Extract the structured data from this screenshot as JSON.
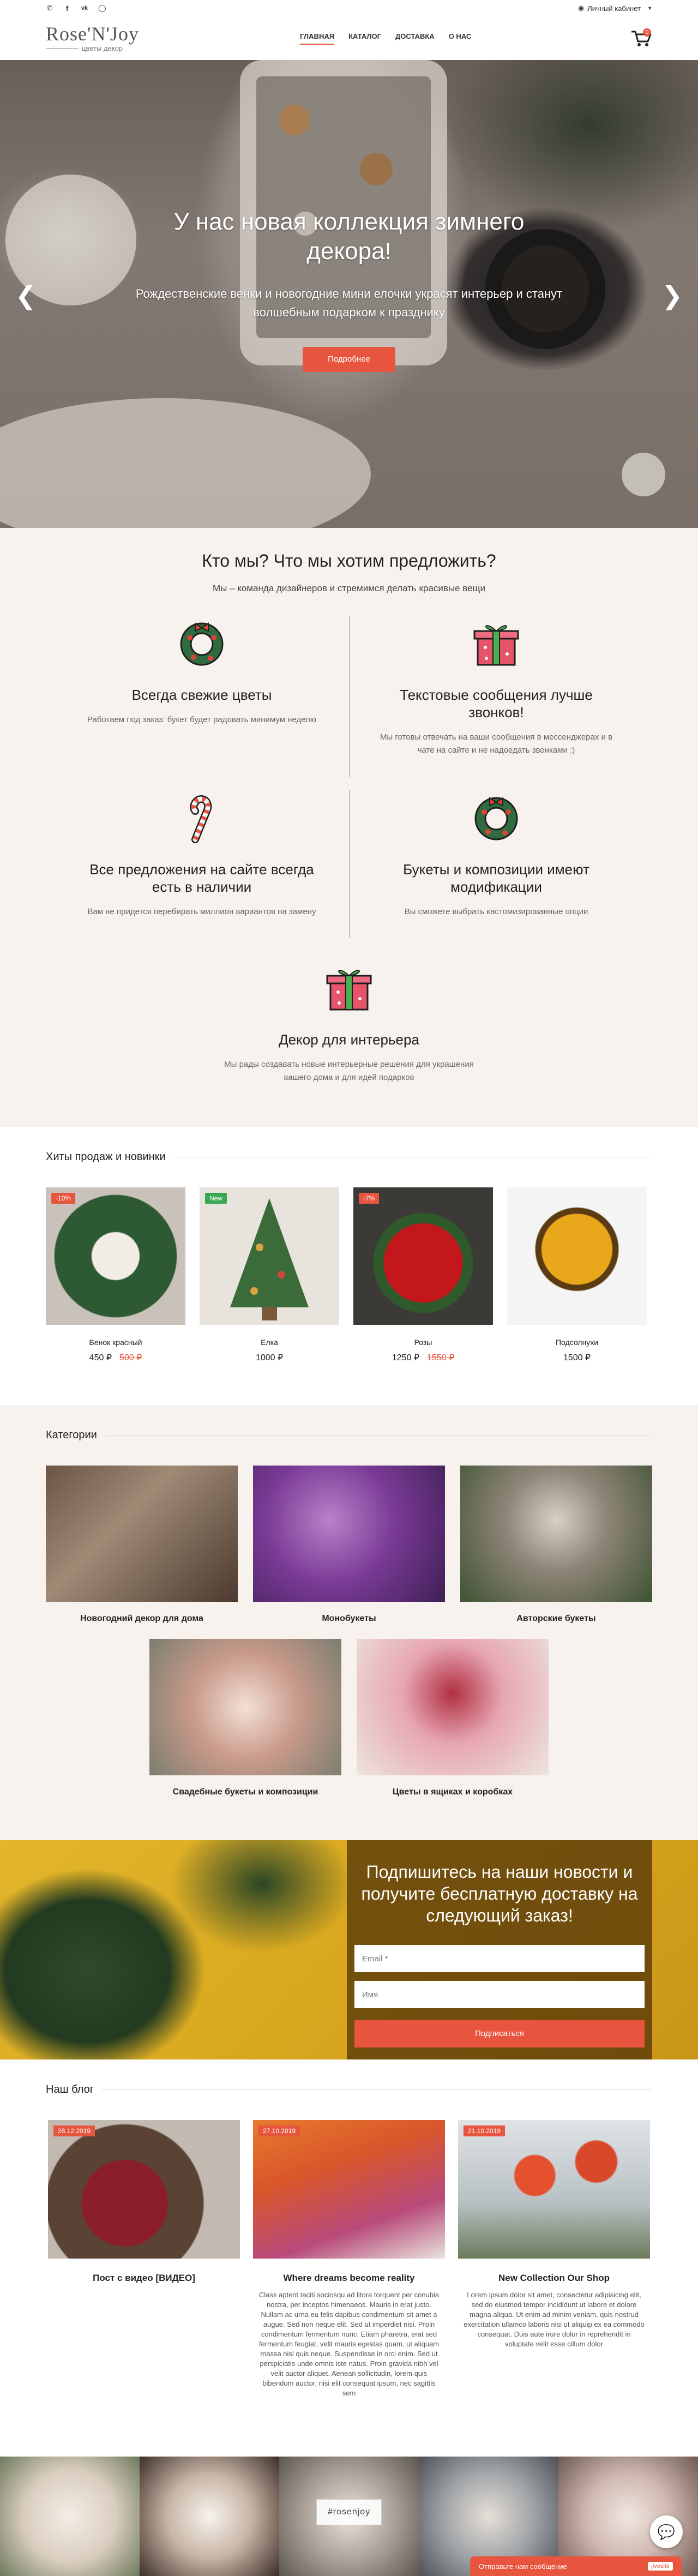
{
  "topbar": {
    "icons": [
      "phone-icon",
      "facebook-icon",
      "vk-icon",
      "instagram-icon"
    ],
    "cabinet_label": "Личный кабинет"
  },
  "header": {
    "brand": "Rose'N'Joy",
    "tagline": "цветы декор",
    "nav": [
      "ГЛАВНАЯ",
      "КАТАЛОГ",
      "ДОСТАВКА",
      "О НАС"
    ],
    "cart_count": "0"
  },
  "hero": {
    "title": "У нас новая коллекция зимнего декора!",
    "text": "Рождественские венки и новогодние мини елочки украсят интерьер и станут волшебным подарком к празднику",
    "button": "Подробнее"
  },
  "about": {
    "title": "Кто мы? Что мы хотим предложить?",
    "lead": "Мы – команда дизайнеров и стремимся делать красивые вещи",
    "features": [
      {
        "icon": "wreath-icon",
        "title": "Всегда свежие цветы",
        "text": "Работаем под заказ: букет будет радовать минимум неделю"
      },
      {
        "icon": "gift-icon",
        "title": "Текстовые сообщения лучше звонков!",
        "text": "Мы готовы отвечать на ваши сообщения в мессенджерах и в чате на сайте и не надоедать звонками :)"
      },
      {
        "icon": "candy-cane-icon",
        "title": "Все предложения на сайте всегда есть в наличии",
        "text": "Вам не придется перебирать миллион вариантов на замену"
      },
      {
        "icon": "wreath-icon",
        "title": "Букеты и композиции имеют модификации",
        "text": "Вы сможете выбрать кастомизированные опции"
      },
      {
        "icon": "gift-icon",
        "title": "Декор для интерьера",
        "text": "Мы рады создавать новые интерьерные решения для украшения вашего дома и для идей подарков"
      }
    ]
  },
  "hits": {
    "title": "Хиты продаж и новинки",
    "products": [
      {
        "name": "Венок красный",
        "price": "450 ₽",
        "old_price": "500 ₽",
        "badge": "-10%"
      },
      {
        "name": "Елка",
        "price": "1000 ₽",
        "old_price": "",
        "badge": "New"
      },
      {
        "name": "Розы",
        "price": "1250 ₽",
        "old_price": "1550 ₽",
        "badge": "-7%"
      },
      {
        "name": "Подсолнухи",
        "price": "1500 ₽",
        "old_price": "",
        "badge": ""
      }
    ]
  },
  "categories": {
    "title": "Категории",
    "items": [
      {
        "label": "Новогодний декор для дома"
      },
      {
        "label": "Монобукеты"
      },
      {
        "label": "Авторские букеты"
      },
      {
        "label": "Свадебные букеты и композиции"
      },
      {
        "label": "Цветы в ящиках и коробках"
      }
    ]
  },
  "subscribe": {
    "title": "Подпишитесь на наши новости и получите бесплатную доставку на следующий заказ!",
    "email_placeholder": "Email *",
    "name_placeholder": "Имя",
    "button": "Подписаться"
  },
  "blog": {
    "title": "Наш блог",
    "posts": [
      {
        "date": "28.12.2019",
        "title": "Пост с видео [ВИДЕО]",
        "text": ""
      },
      {
        "date": "27.10.2019",
        "title": "Where dreams become reality",
        "text": "Class aptent taciti sociosqu ad litora torquent per conubia nostra, per inceptos himenaeos. Mauris in erat justo. Nullam ac urna eu felis dapibus condimentum sit amet a augue. Sed non neque elit. Sed ut imperdiet nisi. Proin condimentum fermentum nunc. Etiam pharetra, erat sed fermentum feugiat, velit mauris egestas quam, ut aliquam massa nisl quis neque. Suspendisse in orci enim. Sed ut perspiciatis unde omnis iste natus. Proin gravida nibh vel velit auctor aliquet. Aenean sollicitudin, lorem quis bibendum auctor, nisi elit consequat ipsum, nec sagittis sem"
      },
      {
        "date": "21.10.2019",
        "title": "New Collection Our Shop",
        "text": "Lorem ipsum dolor sit amet, consectetur adipisicing elit, sed do eiusmod tempor incididunt ut labore et dolore magna aliqua. Ut enim ad minim veniam, quis nostrud exercitation ullamco laboris nisi ut aliquip ex ea commodo consequat. Duis aute irure dolor in reprehendit in voluptate velit esse cillum dolor"
      }
    ]
  },
  "instagram": {
    "tag": "#rosenjoy",
    "chat_label": "Отправьте нам сообщение",
    "chat_brand": "jivosite"
  },
  "colors": {
    "accent": "#e8553e",
    "bg_soft": "#f8f2ef"
  }
}
